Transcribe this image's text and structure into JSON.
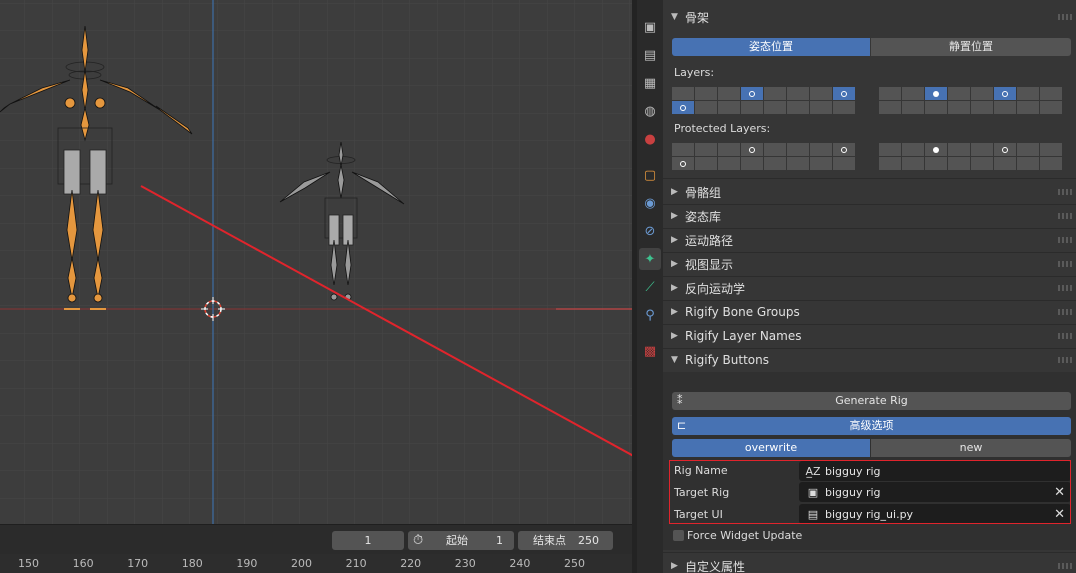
{
  "viewport": {
    "annotation_color": "#e0242c"
  },
  "timeline": {
    "current_frame": "1",
    "start_label": "起始",
    "start_value": "1",
    "end_label": "结束点",
    "end_value": "250",
    "ruler": [
      "150",
      "160",
      "170",
      "180",
      "190",
      "200",
      "210",
      "220",
      "230",
      "240",
      "250"
    ]
  },
  "tabs": [
    "tool-icon",
    "render-icon",
    "output-icon",
    "view-layer-icon",
    "scene-icon",
    "world-icon",
    "object-icon",
    "modifiers-icon",
    "physics-icon",
    "armature-data-icon",
    "bone-icon",
    "bone-constraint-icon",
    "texture-icon"
  ],
  "props": {
    "skeleton_header": "骨架",
    "pose_position": "姿态位置",
    "rest_position": "静置位置",
    "layers_label": "Layers:",
    "protected_label": "Protected Layers:",
    "collapsed": [
      "骨骼组",
      "姿态库",
      "运动路径",
      "视图显示",
      "反向运动学",
      "Rigify Bone Groups",
      "Rigify Layer Names"
    ],
    "rigify_buttons_header": "Rigify Buttons",
    "generate_rig": "Generate Rig",
    "advanced": "高级选项",
    "overwrite": "overwrite",
    "new": "new",
    "rig_name_label": "Rig Name",
    "rig_name_value": "bigguy rig",
    "target_rig_label": "Target Rig",
    "target_rig_value": "bigguy rig",
    "target_ui_label": "Target UI",
    "target_ui_value": "bigguy rig_ui.py",
    "force_widget": "Force Widget Update",
    "custom_props": "自定义属性",
    "accent": "#4772b3"
  }
}
